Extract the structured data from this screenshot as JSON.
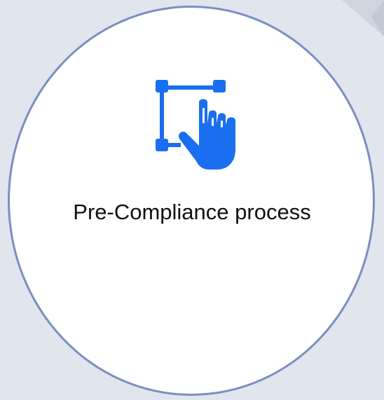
{
  "card": {
    "label": "Pre-Compliance process",
    "icon": "selection-hand-pointer-icon",
    "accent_color": "#1a6ef0",
    "border_color": "#7a8fbf",
    "background_color": "#e1e5ee"
  }
}
